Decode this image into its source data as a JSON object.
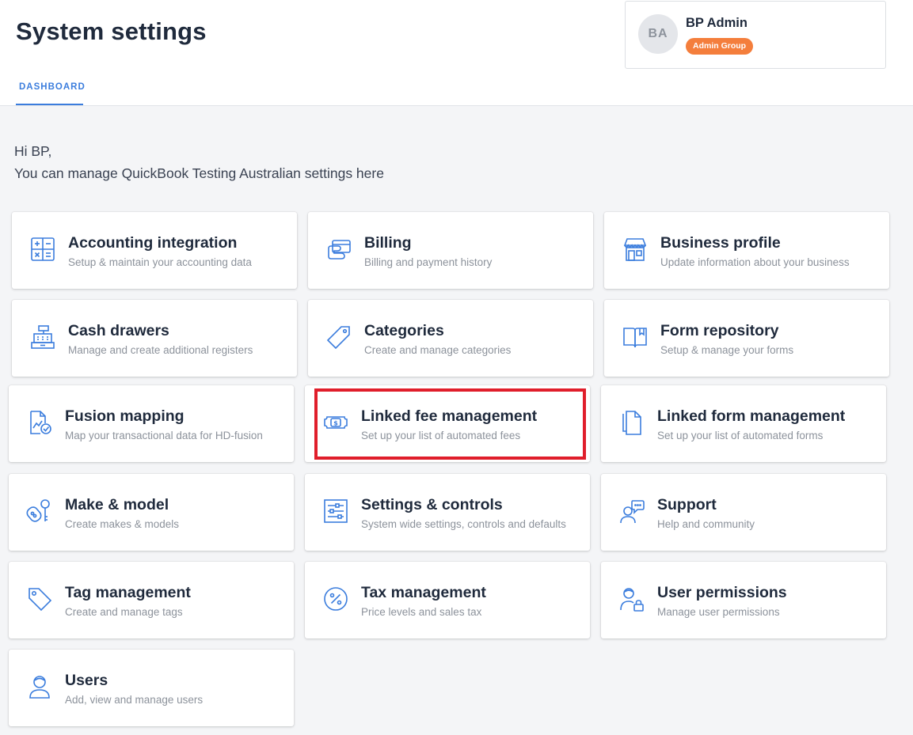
{
  "header": {
    "title": "System settings",
    "tab_dashboard": "DASHBOARD"
  },
  "user": {
    "initials": "BA",
    "name": "BP Admin",
    "group": "Admin Group"
  },
  "greeting": {
    "line1": "Hi BP,",
    "line2": "You can manage QuickBook Testing Australian settings here"
  },
  "colors": {
    "accent": "#3b7ddd",
    "badge": "#f47e3c",
    "highlight": "#e01e2b"
  },
  "cards": [
    {
      "title": "Accounting integration",
      "desc": "Setup & maintain your accounting data",
      "icon": "calculator-icon"
    },
    {
      "title": "Billing",
      "desc": "Billing and payment history",
      "icon": "credit-card-icon"
    },
    {
      "title": "Business profile",
      "desc": "Update information about your business",
      "icon": "storefront-icon"
    },
    {
      "title": "Cash drawers",
      "desc": "Manage and create additional registers",
      "icon": "cash-register-icon"
    },
    {
      "title": "Categories",
      "desc": "Create and manage categories",
      "icon": "tag-outline-icon"
    },
    {
      "title": "Form repository",
      "desc": "Setup & manage your forms",
      "icon": "book-icon"
    },
    {
      "title": "Fusion mapping",
      "desc": "Map your transactional data for HD-fusion",
      "icon": "chart-check-icon"
    },
    {
      "title": "Linked fee management",
      "desc": "Set up your list of automated fees",
      "icon": "banknote-icon"
    },
    {
      "title": "Linked form management",
      "desc": "Set up your list of automated forms",
      "icon": "documents-icon"
    },
    {
      "title": "Make & model",
      "desc": "Create makes & models",
      "icon": "car-key-icon"
    },
    {
      "title": "Settings & controls",
      "desc": "System wide settings, controls and defaults",
      "icon": "sliders-icon"
    },
    {
      "title": "Support",
      "desc": "Help and community",
      "icon": "support-chat-icon"
    },
    {
      "title": "Tag management",
      "desc": "Create and manage tags",
      "icon": "price-tag-icon"
    },
    {
      "title": "Tax management",
      "desc": "Price levels and sales tax",
      "icon": "percent-icon"
    },
    {
      "title": "User permissions",
      "desc": "Manage user permissions",
      "icon": "user-lock-icon"
    },
    {
      "title": "Users",
      "desc": "Add, view and manage users",
      "icon": "user-icon"
    }
  ]
}
